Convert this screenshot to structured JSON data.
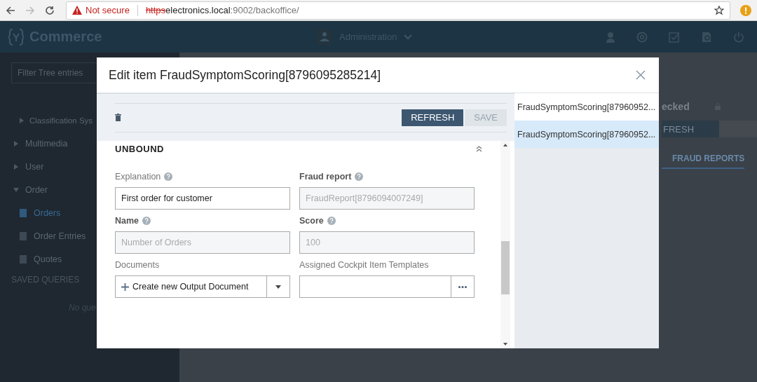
{
  "browser": {
    "security": "Not secure",
    "url_scheme": "https",
    "url_host": "electronics.local",
    "url_path": ":9002/backoffice/"
  },
  "app_header": {
    "logo": "Commerce",
    "perspective": "Administration"
  },
  "sidebar": {
    "filter_placeholder": "Filter Tree entries",
    "tree": [
      {
        "children": [
          {
            "label": "Classification Sys",
            "expanded": false,
            "selected": false
          }
        ]
      },
      {
        "label": "Multimedia",
        "expanded": false,
        "selected": false
      },
      {
        "label": "User",
        "expanded": false,
        "selected": false
      },
      {
        "label": "Order",
        "expanded": true,
        "selected": false,
        "children": [
          {
            "label": "Orders",
            "selected": true
          },
          {
            "label": "Order Entries",
            "selected": false
          },
          {
            "label": "Quotes",
            "selected": false
          }
        ]
      }
    ],
    "saved_queries": {
      "heading": "SAVED QUERIES",
      "empty_text": "No que"
    }
  },
  "background_editor": {
    "status": "ecked",
    "button": "FRESH",
    "tabs": [
      {
        "label": "FRAUD REPORTS",
        "selected": true
      }
    ]
  },
  "modal": {
    "title": "Edit item FraudSymptomScoring[8796095285214]",
    "toolbar": {
      "buttons": [
        {
          "label": "REFRESH",
          "disabled": false
        },
        {
          "label": "SAVE",
          "disabled": true
        }
      ]
    },
    "section": {
      "title": "UNBOUND"
    },
    "fields": [
      {
        "label": "Explanation",
        "help": true,
        "emphasized": false,
        "kind": "text",
        "value": "First order for customer"
      },
      {
        "label": "Fraud report",
        "help": true,
        "emphasized": true,
        "kind": "readonly",
        "value": "FraudReport[8796094007249]"
      },
      {
        "label": "Name",
        "help": true,
        "emphasized": true,
        "kind": "readonly",
        "value": "Number of Orders"
      },
      {
        "label": "Score",
        "help": true,
        "emphasized": true,
        "kind": "readonly",
        "value": "100"
      },
      {
        "label": "Documents",
        "help": false,
        "emphasized": false,
        "kind": "create",
        "value": "Create new Output Document"
      },
      {
        "label": "Assigned Cockpit Item Templates",
        "help": false,
        "emphasized": false,
        "kind": "reference"
      }
    ],
    "history": [
      {
        "label": "FraudSymptomScoring[87960952...",
        "selected": false
      },
      {
        "label": "FraudSymptomScoring[87960952...",
        "selected": true
      }
    ]
  }
}
